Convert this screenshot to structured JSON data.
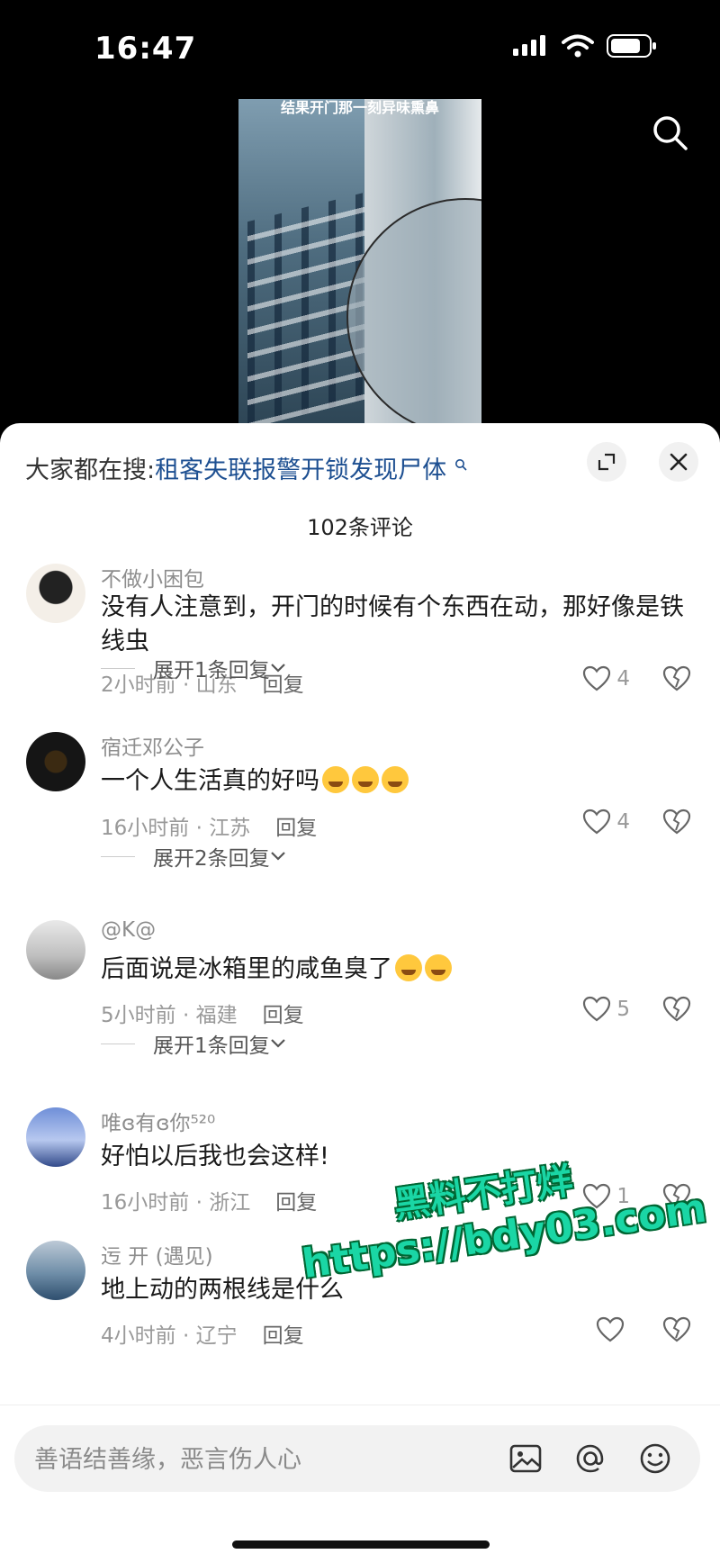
{
  "status_bar": {
    "time": "16:47"
  },
  "video": {
    "caption": "结果开门那一刻异味熏鼻"
  },
  "sheet": {
    "hot_search_prefix": "大家都在搜:",
    "hot_search_keyword": "租客失联报警开锁发现尸体",
    "comment_count": "102条评论"
  },
  "comments": [
    {
      "username": "不做小困包",
      "text": "没有人注意到，开门的时候有个东西在动，那好像是铁线虫",
      "time_location": "2小时前 · 山东",
      "reply_label": "回复",
      "likes": "4",
      "expand_label": "展开1条回复"
    },
    {
      "username": "宿迁邓公子",
      "text": "一个人生活真的好吗",
      "time_location": "16小时前 · 江苏",
      "reply_label": "回复",
      "likes": "4",
      "expand_label": "展开2条回复"
    },
    {
      "username": "@K@",
      "text": "后面说是冰箱里的咸鱼臭了",
      "time_location": "5小时前 · 福建",
      "reply_label": "回复",
      "likes": "5",
      "expand_label": "展开1条回复"
    },
    {
      "username": "唯ɞ有ɞ你⁵²⁰",
      "text": "好怕以后我也会这样!",
      "time_location": "16小时前 · 浙江",
      "reply_label": "回复",
      "likes": "1"
    },
    {
      "username": "迃  开 (遇见)",
      "text": "地上动的两根线是什么",
      "time_location": "4小时前 · 辽宁",
      "reply_label": "回复",
      "likes": ""
    }
  ],
  "watermark": {
    "line1": "黑料不打烊",
    "line2": "https://bdy03.com"
  },
  "input": {
    "placeholder": "善语结善缘，恶言伤人心"
  },
  "colors": {
    "keyword": "#1d4f91",
    "watermark": "#1ad6a5"
  }
}
